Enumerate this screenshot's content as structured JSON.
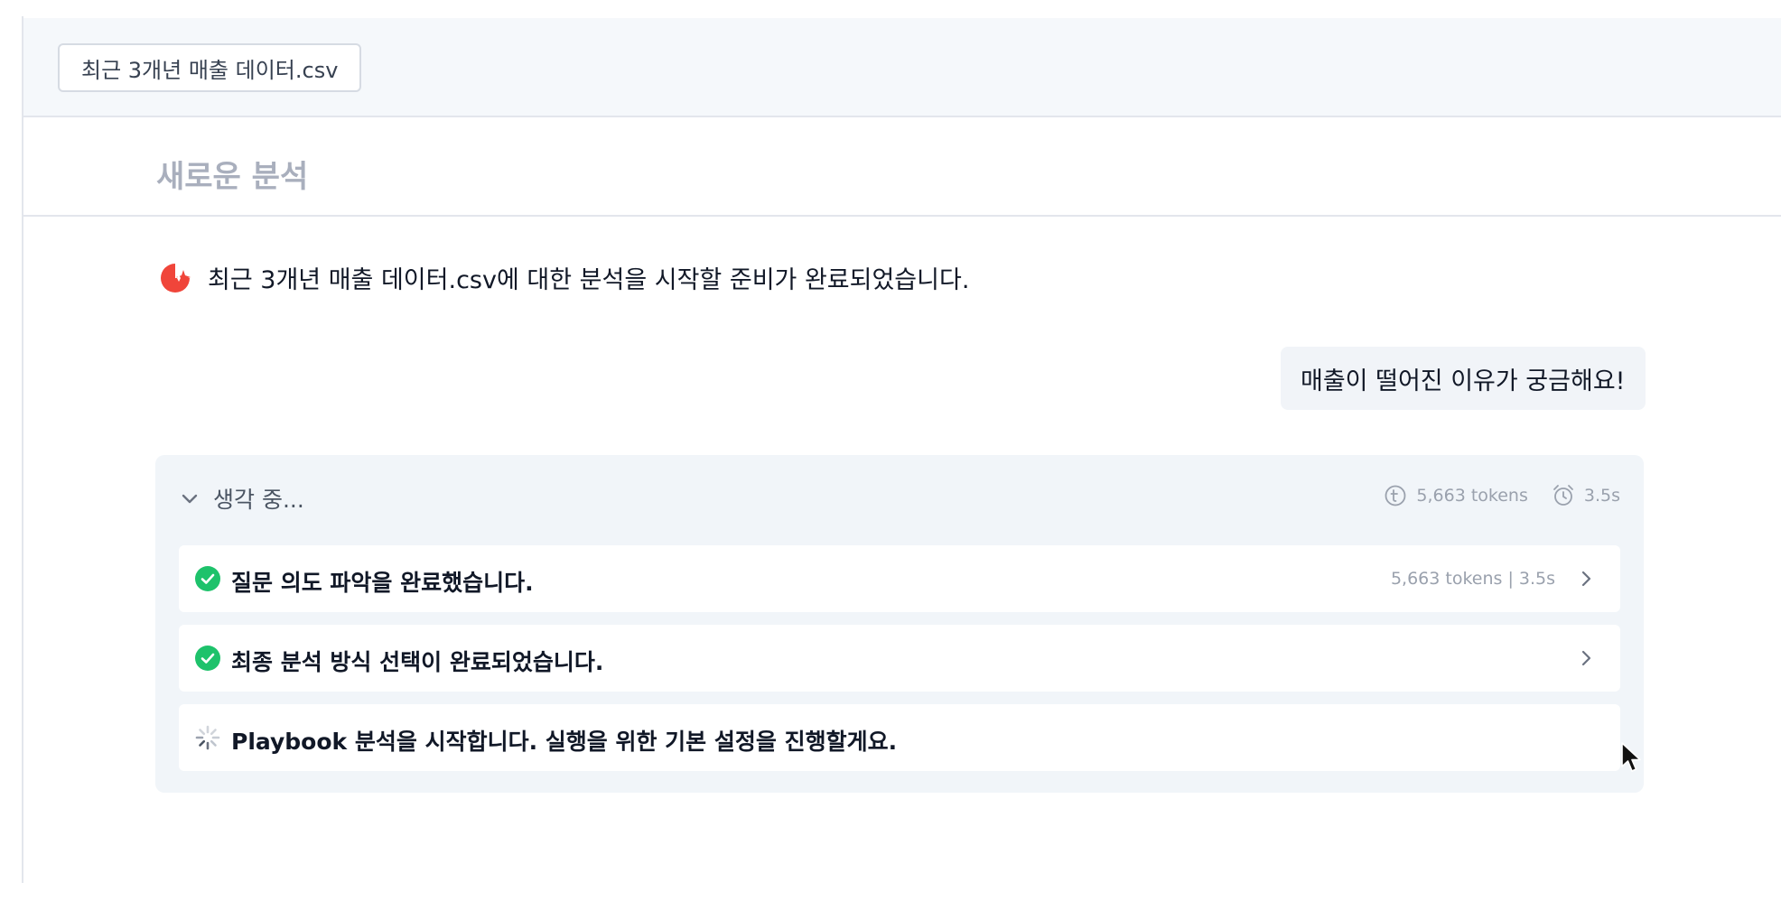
{
  "file_bar": {
    "file_name": "최근 3개년 매출 데이터.csv"
  },
  "page": {
    "title": "새로운 분석"
  },
  "assistant_message": {
    "text": "최근 3개년 매출 데이터.csv에 대한 분석을 시작할 준비가 완료되었습니다.",
    "icon": "sparkle-logo-icon",
    "accent_color": "#f0453a"
  },
  "user_message": {
    "text": "매출이 떨어진 이유가 궁금해요!"
  },
  "thinking": {
    "label": "생각 중...",
    "tokens": "5,663 tokens",
    "duration": "3.5s",
    "steps": [
      {
        "status": "done",
        "text": "질문 의도 파악을 완료했습니다.",
        "meta": "5,663 tokens | 3.5s"
      },
      {
        "status": "done",
        "text": "최종 분석 방식 선택이 완료되었습니다.",
        "meta": ""
      },
      {
        "status": "loading",
        "text": "Playbook 분석을 시작합니다. 실행을 위한 기본 설정을 진행할게요.",
        "meta": ""
      }
    ],
    "done_color": "#1ec26b"
  }
}
